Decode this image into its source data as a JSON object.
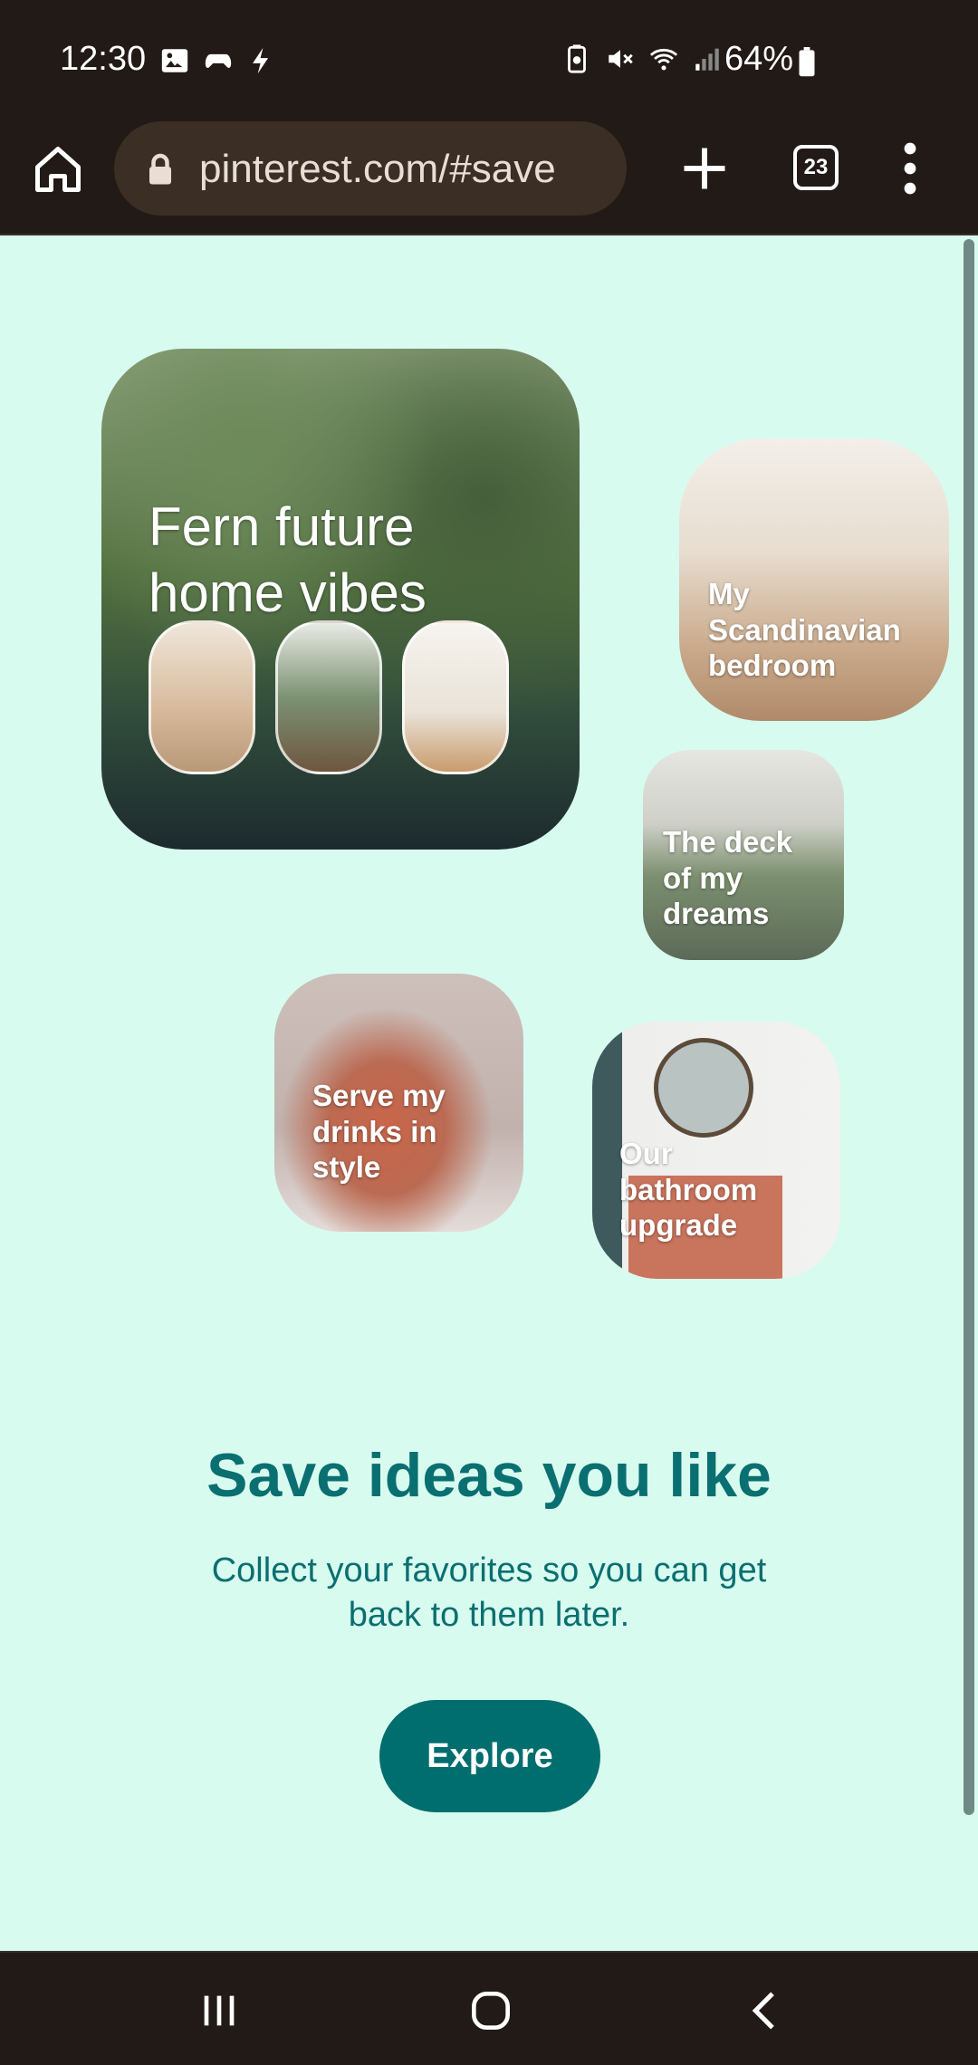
{
  "status_bar": {
    "time": "12:30",
    "battery": "64%",
    "left_icons": [
      "gallery-icon",
      "game-controller-icon",
      "charging-bolt-icon"
    ],
    "right_icons": [
      "battery-saver-icon",
      "mute-icon",
      "wifi-icon",
      "signal-icon",
      "battery-icon"
    ]
  },
  "browser": {
    "url": "pinterest.com/#save",
    "tab_count": "23"
  },
  "boards": {
    "fern": "Fern future home vibes",
    "scandi": "My Scandinavian bedroom",
    "deck": "The deck of my dreams",
    "pitcher": "Serve my drinks in style",
    "bath": "Our bathroom upgrade"
  },
  "main": {
    "headline": "Save ideas you like",
    "subtext": "Collect your favorites so you can get back to them later.",
    "explore_label": "Explore"
  },
  "nav": {
    "items": [
      "recent-apps",
      "home",
      "back"
    ]
  },
  "colors": {
    "background": "#d8fbf0",
    "accent": "#006d6e",
    "headline": "#0a6f70",
    "system_bars": "#221a16"
  }
}
